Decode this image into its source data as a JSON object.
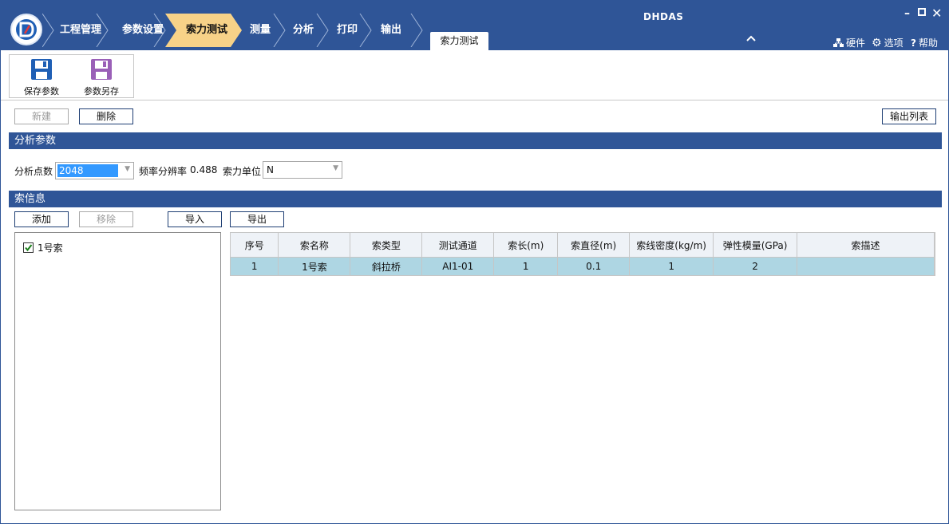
{
  "app": {
    "title": "DHDAS"
  },
  "nav": [
    {
      "label": "工程管理"
    },
    {
      "label": "参数设置"
    },
    {
      "label": "索力测试"
    },
    {
      "label": "测量"
    },
    {
      "label": "分析"
    },
    {
      "label": "打印"
    },
    {
      "label": "输出"
    }
  ],
  "active_tab": {
    "label": "索力测试"
  },
  "topright": {
    "hardware": "硬件",
    "options": "选项",
    "help": "帮助"
  },
  "ribbon": {
    "save": "保存参数",
    "save_as": "参数另存"
  },
  "toolbar": {
    "new": "新建",
    "delete": "删除",
    "export_list": "输出列表"
  },
  "analysis": {
    "header": "分析参数",
    "points_label": "分析点数",
    "points_value": "2048",
    "freq_res_label": "频率分辨率",
    "freq_res_value": "0.488",
    "unit_label": "索力单位",
    "unit_value": "N"
  },
  "cable_info": {
    "header": "索信息",
    "add": "添加",
    "remove": "移除",
    "import": "导入",
    "export": "导出",
    "tree_items": [
      {
        "label": "1号索",
        "checked": true
      }
    ]
  },
  "table": {
    "columns": [
      "序号",
      "索名称",
      "索类型",
      "测试通道",
      "索长(m)",
      "索直径(m)",
      "索线密度(kg/m)",
      "弹性模量(GPa)",
      "索描述"
    ],
    "rows": [
      [
        "1",
        "1号索",
        "斜拉桥",
        "AI1-01",
        "1",
        "0.1",
        "1",
        "2",
        ""
      ]
    ]
  },
  "colors": {
    "brand": "#2f5597",
    "nav_active": "#f7d288",
    "row_selected": "#aed6e3"
  }
}
